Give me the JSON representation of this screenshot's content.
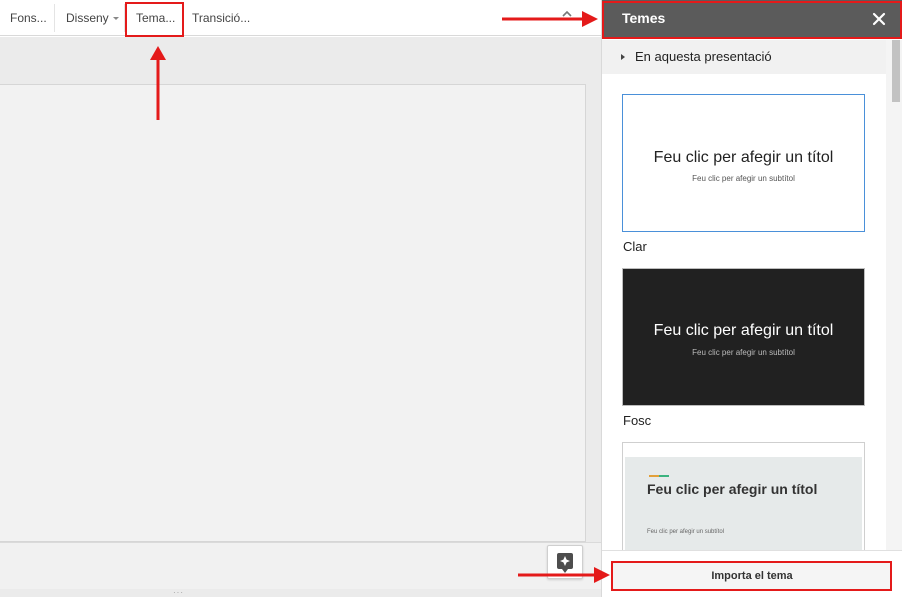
{
  "toolbar": {
    "items": [
      {
        "label": "Fons..."
      },
      {
        "label": "Disseny"
      },
      {
        "label": "Tema..."
      },
      {
        "label": "Transició..."
      }
    ]
  },
  "panel": {
    "title": "Temes",
    "close_icon": "close-icon",
    "section_label": "En aquesta presentació",
    "themes": [
      {
        "name": "Clar",
        "title": "Feu clic per afegir un títol",
        "subtitle": "Feu clic per afegir un subtítol"
      },
      {
        "name": "Fosc",
        "title": "Feu clic per afegir un títol",
        "subtitle": "Feu clic per afegir un subtítol"
      },
      {
        "name": "",
        "title": "Feu clic per afegir un títol",
        "subtitle": "Feu clic per afegir un subtítol"
      }
    ],
    "import_button": "Importa el tema"
  },
  "colors": {
    "annotation_red": "#e41a1a",
    "panel_header": "#5b5b5b",
    "selected_border": "#4a90d9",
    "dark_theme_bg": "#212121"
  }
}
